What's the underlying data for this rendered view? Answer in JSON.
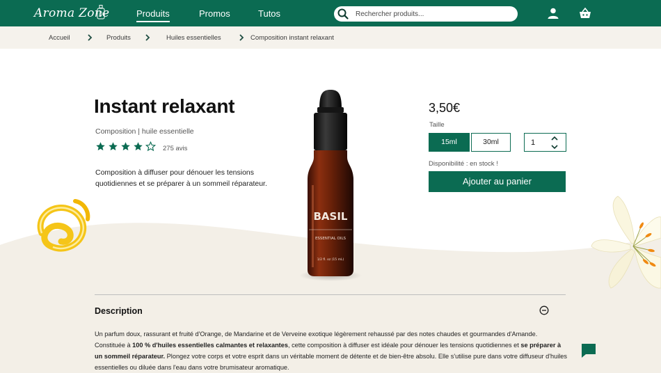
{
  "header": {
    "logo_text": "Aroma Zone",
    "nav": [
      {
        "label": "Produits"
      },
      {
        "label": "Promos"
      },
      {
        "label": "Tutos"
      }
    ],
    "search_placeholder": "Rechercher produits..."
  },
  "breadcrumb": [
    "Accueil",
    "Produits",
    "Huiles essentielles",
    "Composition instant relaxant"
  ],
  "product": {
    "title": "Instant relaxant",
    "subtitle": "Composition | huile essentielle",
    "rating": 4,
    "rating_max": 5,
    "reviews": "275 avis",
    "short_description": "Composition à diffuser pour dénouer les tensions quotidiennes et se préparer à un sommeil réparateur.",
    "bottle": {
      "label": "BASIL",
      "sublabel": "ESSENTIAL OILS",
      "volume": "1/2 fl. oz (15 mL)"
    }
  },
  "purchase": {
    "price": "3,50€",
    "size_label": "Taille",
    "sizes": [
      {
        "label": "15ml",
        "selected": true
      },
      {
        "label": "30ml",
        "selected": false
      }
    ],
    "quantity": "1",
    "availability": "Disponibilité : en stock !",
    "add_to_cart": "Ajouter au panier"
  },
  "description": {
    "title": "Description",
    "p1": "Un parfum doux, rassurant et fruité d'Orange, de Mandarine et de Verveine exotique légèrement rehaussé par des notes chaudes et gourmandes d'Amande.",
    "p2a": "Constituée à ",
    "p2b": "100 % d'huiles essentielles calmantes et relaxantes",
    "p2c": ", cette composition à diffuser est idéale pour dénouer les tensions quotidiennes et ",
    "p2d": "se préparer à un sommeil réparateur.",
    "p2e": " Plongez votre corps et votre esprit dans un véritable moment de détente et de bien-être absolu. Elle s'utilise pure dans votre diffuseur d'huiles essentielles ou diluée dans l'eau dans votre brumisateur aromatique."
  },
  "colors": {
    "brand_green": "#0b6b52",
    "breadcrumb_bg": "#f5f2ec",
    "wave_bg": "#f3efe7"
  },
  "icons": [
    "search-icon",
    "user-icon",
    "basket-icon",
    "chevron-right-icon",
    "star-icon",
    "chevron-up-icon",
    "chevron-down-icon",
    "minus-circle-icon",
    "chat-icon"
  ]
}
